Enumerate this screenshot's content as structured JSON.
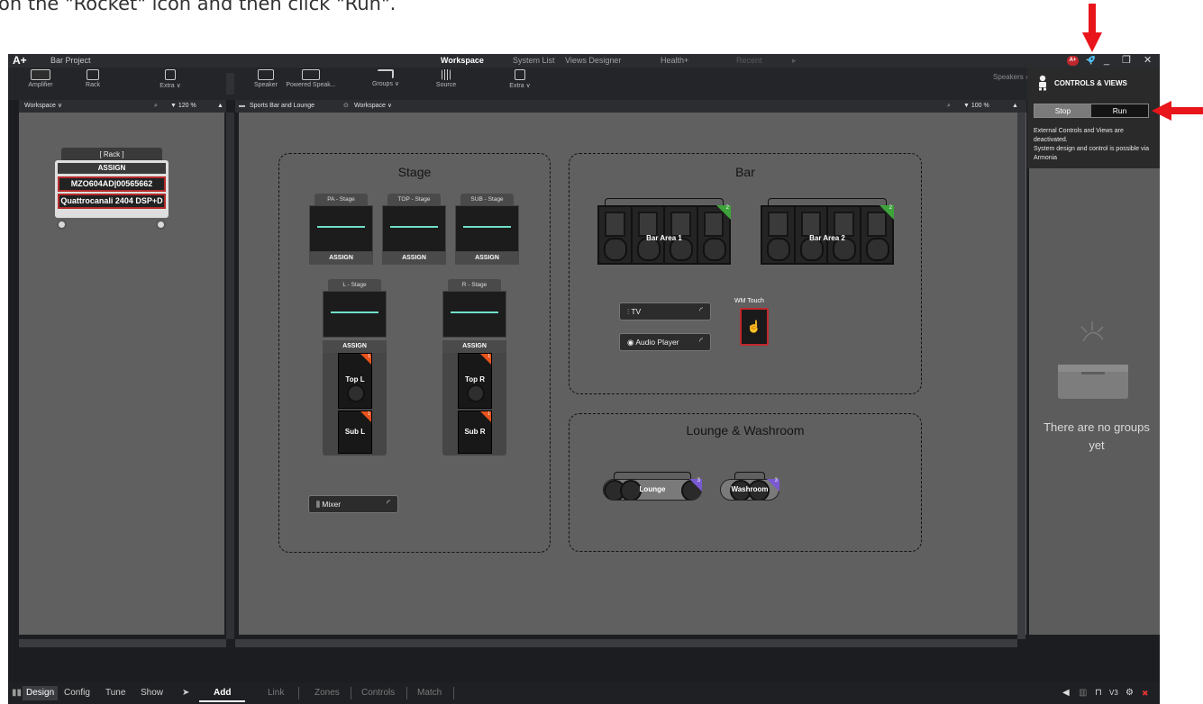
{
  "instruction": {
    "text": "on the \"Rocket\" icon and then click \"Run\"."
  },
  "titlebar": {
    "logo": "A+",
    "project": "Bar Project",
    "tabs": [
      "Workspace",
      "System List",
      "Views Designer",
      "Health+",
      "Recent"
    ],
    "a_badge": "A+",
    "min": "_",
    "restore": "❐",
    "close": "✕"
  },
  "toolbar": {
    "left": [
      {
        "label": "Amplifier"
      },
      {
        "label": "Rack"
      },
      {
        "label": "Extra ∨"
      }
    ],
    "main": [
      {
        "label": "Speaker"
      },
      {
        "label": "Powered Speak..."
      },
      {
        "label": "Groups ∨"
      },
      {
        "label": "Source"
      },
      {
        "label": "Extra ∨"
      }
    ],
    "speakers_label": "Speakers ›"
  },
  "left_header": {
    "view": "Workspace ∨",
    "zoom": "▼ 120 %"
  },
  "main_header": {
    "breadcrumb": "Sports Bar and Lounge",
    "view": "Workspace ∨",
    "zoom": "▼ 100 %"
  },
  "rack": {
    "title": "[ Rack ]",
    "assign": "ASSIGN",
    "devices": [
      "MZO604AD|00565662",
      "Quattrocanali 2404 DSP+D"
    ]
  },
  "zones": {
    "stage": {
      "title": "Stage",
      "speakers": [
        {
          "label": "PA - Stage",
          "assign": "ASSIGN"
        },
        {
          "label": "TOP - Stage",
          "assign": "ASSIGN"
        },
        {
          "label": "SUB - Stage",
          "assign": "ASSIGN"
        }
      ],
      "arrays": [
        {
          "label": "L - Stage",
          "assign": "ASSIGN",
          "cabs": [
            {
              "name": "Top L",
              "num": "1"
            },
            {
              "name": "Sub L",
              "num": "1"
            }
          ]
        },
        {
          "label": "R - Stage",
          "assign": "ASSIGN",
          "cabs": [
            {
              "name": "Top R",
              "num": "1"
            },
            {
              "name": "Sub R",
              "num": "1"
            }
          ]
        }
      ],
      "mixer": "Mixer"
    },
    "bar": {
      "title": "Bar",
      "arrays": [
        {
          "name": "Bar Area 1",
          "num": "2"
        },
        {
          "name": "Bar Area 2",
          "num": "2"
        }
      ],
      "tv": "TV",
      "audio_player": "Audio Player",
      "wm_touch": "WM Touch"
    },
    "lounge": {
      "title": "Lounge & Washroom",
      "arrays": [
        {
          "name": "Lounge",
          "num": "3"
        },
        {
          "name": "Washroom",
          "num": "3"
        }
      ]
    }
  },
  "controls_views": {
    "title": "CONTROLS & VIEWS",
    "stop": "Stop",
    "run": "Run",
    "desc1": "External Controls and Views are deactivated.",
    "desc2": "System design and control is possible via Armonia"
  },
  "groups": {
    "empty": "There are no groups yet"
  },
  "bottombar": {
    "modes": [
      "Design",
      "Config",
      "Tune",
      "Show"
    ],
    "tabs": [
      "Add",
      "Link",
      "Zones",
      "Controls",
      "Match"
    ],
    "counter": "V3"
  },
  "colors": {
    "accent_red": "#e8151b",
    "array_orange": "#e8531d",
    "array_green": "#3da33a",
    "array_purple": "#7a5ad2"
  }
}
